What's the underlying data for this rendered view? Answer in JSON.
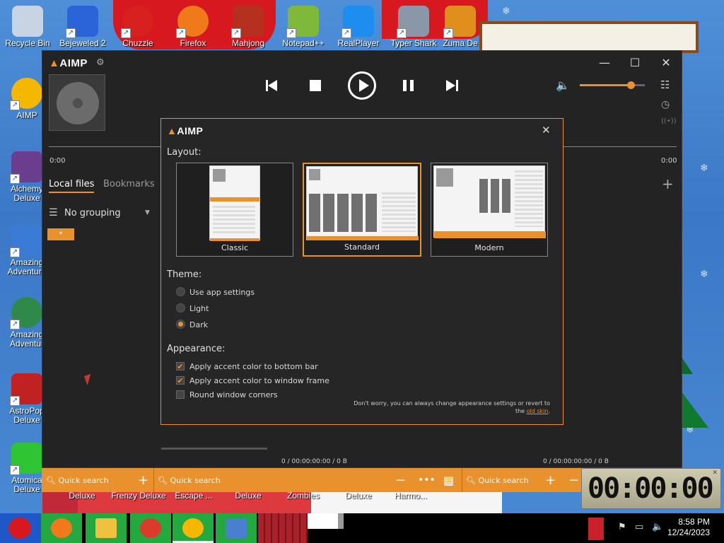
{
  "desktop": {
    "top_icons": [
      {
        "label": "Recycle Bin",
        "icon": "recycle-bin-icon",
        "color": "#c8d4e4"
      },
      {
        "label": "Bejeweled 2",
        "icon": "bejeweled-icon",
        "color": "#2b63d9"
      },
      {
        "label": "Chuzzle",
        "icon": "chuzzle-icon",
        "color": "#d92020"
      },
      {
        "label": "Firefox",
        "icon": "firefox-icon",
        "color": "#f07a1a"
      },
      {
        "label": "Mahjong",
        "icon": "mahjong-icon",
        "color": "#b5311d"
      },
      {
        "label": "Notepad++",
        "icon": "notepadpp-icon",
        "color": "#7fb93a"
      },
      {
        "label": "RealPlayer",
        "icon": "realplayer-icon",
        "color": "#1d8ef0"
      },
      {
        "label": "Typer Shark",
        "icon": "typer-shark-icon",
        "color": "#8a97a8"
      },
      {
        "label": "Zuma De",
        "icon": "zuma-icon",
        "color": "#e08f1d"
      }
    ],
    "left_icons": [
      {
        "label": "AIMP",
        "icon": "aimp-icon",
        "color": "#f5b800"
      },
      {
        "label": "Alchemy Deluxe",
        "icon": "alchemy-icon",
        "color": "#6a3d8f"
      },
      {
        "label": "Amazing Adventure",
        "icon": "amazing-adventures-icon",
        "color": "#3a7bd5"
      },
      {
        "label": "Amazing Adventur",
        "icon": "amazing-adventures-2-icon",
        "color": "#2f8a4a"
      },
      {
        "label": "AstroPop Deluxe",
        "icon": "astropop-icon",
        "color": "#c02121"
      },
      {
        "label": "Atomica Deluxe",
        "icon": "atomica-icon",
        "color": "#2fc433"
      }
    ],
    "bottom_labels": [
      "Deluxe",
      "Frenzy Deluxe",
      "Escape ...",
      "Deluxe",
      "Zombies",
      "Deluxe",
      "Harmo..."
    ]
  },
  "player": {
    "logo": "AIMP",
    "settings_icon": "gear-icon",
    "window_controls": {
      "minimize": "—",
      "maximize": "☐",
      "close": "✕"
    },
    "time_elapsed": "0:00",
    "time_total": "0:00",
    "volume_level": 0.78,
    "tabs": [
      {
        "label": "Local files",
        "active": true
      },
      {
        "label": "Bookmarks",
        "active": false
      }
    ],
    "add_tab": "+",
    "grouping_label": "No grouping",
    "playlist_tag": "*",
    "status_left": "0 / 00:00:00:00 / 0 B",
    "status_right": "0 / 00:00:00:00 / 0 B",
    "quick_search": "Quick search",
    "accent": "#e8912d"
  },
  "dialog": {
    "logo": "AIMP",
    "close": "✕",
    "layout_heading": "Layout:",
    "layouts": [
      {
        "label": "Classic",
        "selected": false
      },
      {
        "label": "Standard",
        "selected": true
      },
      {
        "label": "Modern",
        "selected": false
      }
    ],
    "theme_heading": "Theme:",
    "themes": [
      {
        "label": "Use app settings",
        "selected": false
      },
      {
        "label": "Light",
        "selected": false
      },
      {
        "label": "Dark",
        "selected": true
      }
    ],
    "appearance_heading": "Appearance:",
    "appearance": [
      {
        "label": "Apply accent color to bottom bar",
        "checked": true
      },
      {
        "label": "Apply accent color to window frame",
        "checked": true
      },
      {
        "label": "Round window corners",
        "checked": false
      }
    ],
    "note_line1": "Don't worry, you can always change appearance settings or revert to",
    "note_prefix": "the ",
    "note_link": "old skin",
    "note_suffix": "."
  },
  "taskbar": {
    "time": "8:58 PM",
    "date": "12/24/2023",
    "apps": [
      {
        "icon": "firefox-icon",
        "color": "#f07a1a"
      },
      {
        "icon": "file-explorer-icon",
        "color": "#f0c040"
      },
      {
        "icon": "chrome-icon",
        "color": "#db3b2b"
      },
      {
        "icon": "aimp-icon",
        "color": "#f5b800"
      },
      {
        "icon": "network-computer-icon",
        "color": "#4a7fd0"
      }
    ]
  },
  "clock_widget": {
    "digits": "00:00:00"
  }
}
